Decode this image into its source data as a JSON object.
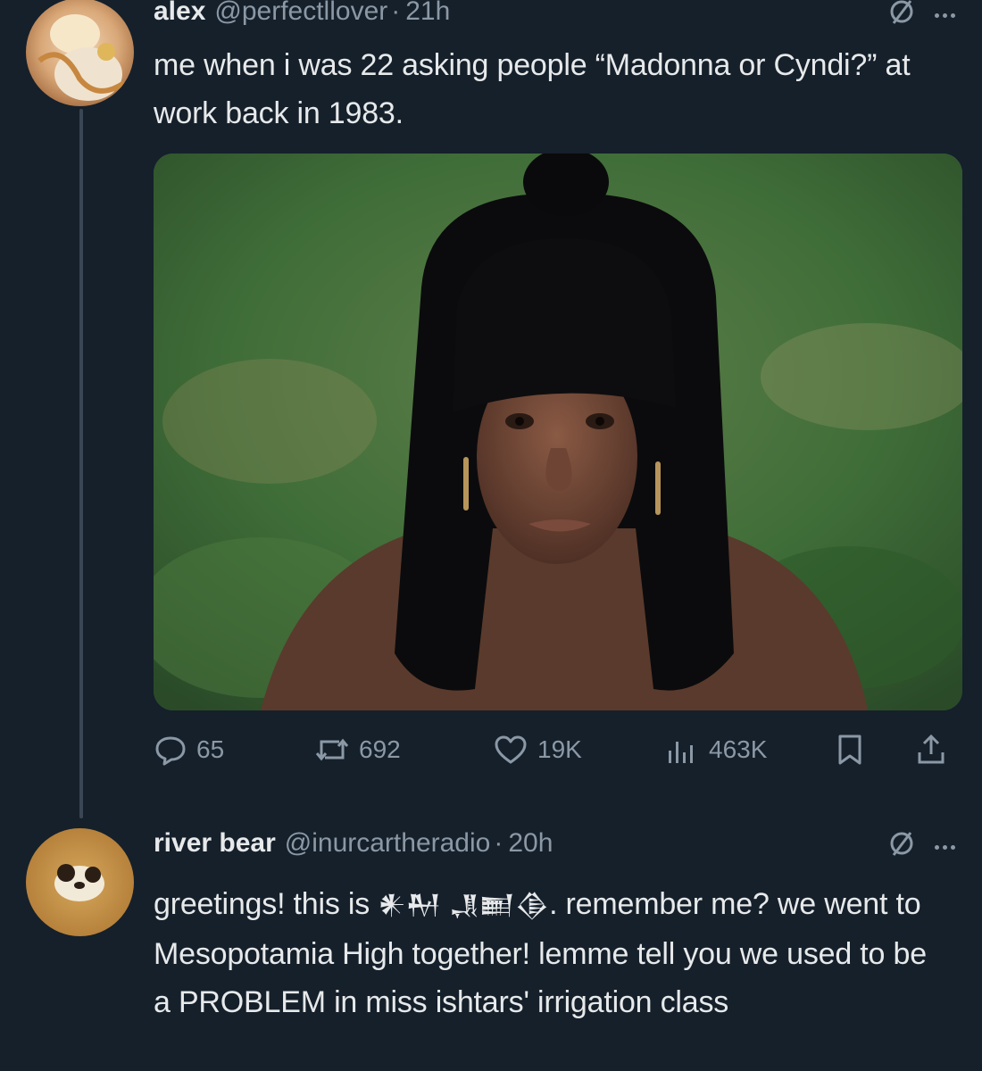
{
  "tweets": [
    {
      "author_name": "alex",
      "handle": "@perfectllover",
      "separator": "·",
      "time": "21h",
      "text": "me when i was 22 asking people “Madonna or Cyndi?” at work back in 1983.",
      "media_icon": "photo",
      "stats": {
        "replies": "65",
        "reposts": "692",
        "likes": "19K",
        "views": "463K"
      }
    },
    {
      "author_name": "river bear",
      "handle": "@inurcartheradio",
      "separator": "·",
      "time": "20h",
      "text_before": "greetings! this is ",
      "glyphs": "𒀭𒈹 𒂗𒆤𒆠",
      "text_after": ". remember me? we went to Mesopotamia High together! lemme tell you we used to be a PROBLEM in miss ishtars' irrigation class"
    }
  ],
  "icons": {
    "verified_slash": "circle-slash-icon",
    "more": "more-icon",
    "reply": "reply-icon",
    "repost": "repost-icon",
    "like": "like-icon",
    "views": "views-icon",
    "bookmark": "bookmark-icon",
    "share": "share-icon"
  },
  "colors": {
    "background": "#15202b",
    "text": "#e7e9ea",
    "muted": "#8b98a5"
  }
}
